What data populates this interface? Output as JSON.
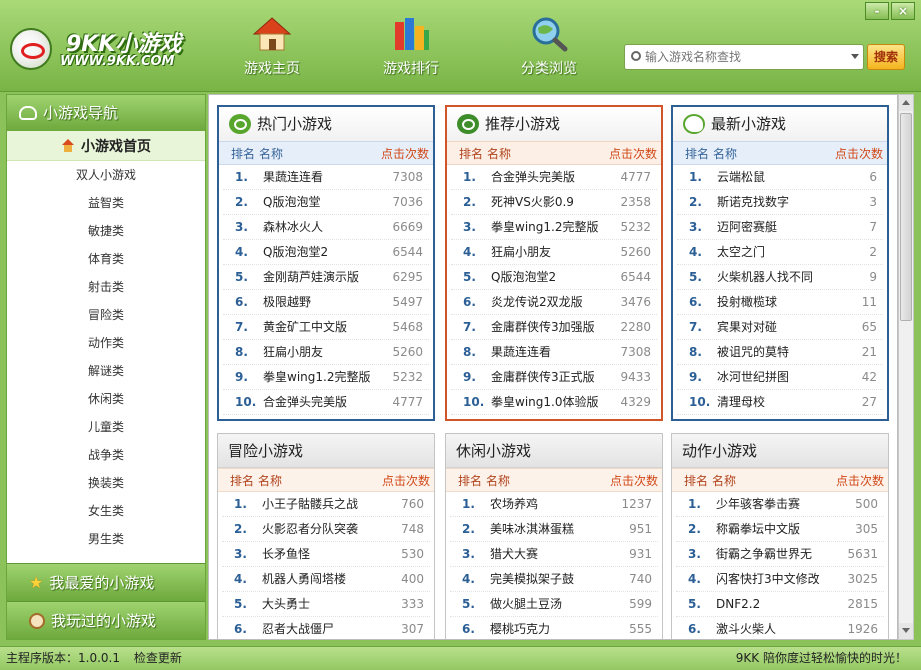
{
  "app": {
    "logo_title": "9KK小游戏",
    "logo_url": "WWW.9KK.COM",
    "window_controls": [
      "-",
      "×"
    ]
  },
  "nav": [
    {
      "label": "游戏主页",
      "icon": "house-icon"
    },
    {
      "label": "游戏排行",
      "icon": "books-icon"
    },
    {
      "label": "分类浏览",
      "icon": "magnifier-globe-icon"
    }
  ],
  "search": {
    "placeholder": "输入游戏名称查找",
    "button": "搜索"
  },
  "sidebar": {
    "title": "小游戏导航",
    "home": "小游戏首页",
    "items": [
      "双人小游戏",
      "益智类",
      "敏捷类",
      "体育类",
      "射击类",
      "冒险类",
      "动作类",
      "解谜类",
      "休闲类",
      "儿童类",
      "战争类",
      "换装类",
      "女生类",
      "男生类"
    ],
    "favorites": "我最爱的小游戏",
    "played": "我玩过的小游戏"
  },
  "columns": {
    "rank": "排名",
    "name": "名称",
    "clicks": "点击次数"
  },
  "panels": [
    {
      "title": "热门小游戏",
      "rows": [
        {
          "rank": "1.",
          "name": "果蔬连连看",
          "clicks": "7308"
        },
        {
          "rank": "2.",
          "name": "Q版泡泡堂",
          "clicks": "7036"
        },
        {
          "rank": "3.",
          "name": "森林冰火人",
          "clicks": "6669"
        },
        {
          "rank": "4.",
          "name": "Q版泡泡堂2",
          "clicks": "6544"
        },
        {
          "rank": "5.",
          "name": "金刚葫芦娃演示版",
          "clicks": "6295"
        },
        {
          "rank": "6.",
          "name": "极限越野",
          "clicks": "5497"
        },
        {
          "rank": "7.",
          "name": "黄金矿工中文版",
          "clicks": "5468"
        },
        {
          "rank": "8.",
          "name": "狂扁小朋友",
          "clicks": "5260"
        },
        {
          "rank": "9.",
          "name": "拳皇wing1.2完整版",
          "clicks": "5232"
        },
        {
          "rank": "10.",
          "name": "合金弹头完美版",
          "clicks": "4777"
        }
      ]
    },
    {
      "title": "推荐小游戏",
      "rows": [
        {
          "rank": "1.",
          "name": "合金弹头完美版",
          "clicks": "4777"
        },
        {
          "rank": "2.",
          "name": "死神VS火影0.9",
          "clicks": "2358"
        },
        {
          "rank": "3.",
          "name": "拳皇wing1.2完整版",
          "clicks": "5232"
        },
        {
          "rank": "4.",
          "name": "狂扁小朋友",
          "clicks": "5260"
        },
        {
          "rank": "5.",
          "name": "Q版泡泡堂2",
          "clicks": "6544"
        },
        {
          "rank": "6.",
          "name": "炎龙传说2双龙版",
          "clicks": "3476"
        },
        {
          "rank": "7.",
          "name": "金庸群侠传3加强版",
          "clicks": "2280"
        },
        {
          "rank": "8.",
          "name": "果蔬连连看",
          "clicks": "7308"
        },
        {
          "rank": "9.",
          "name": "金庸群侠传3正式版",
          "clicks": "9433"
        },
        {
          "rank": "10.",
          "name": "拳皇wing1.0体验版",
          "clicks": "4329"
        }
      ]
    },
    {
      "title": "最新小游戏",
      "rows": [
        {
          "rank": "1.",
          "name": "云端松鼠",
          "clicks": "6"
        },
        {
          "rank": "2.",
          "name": "斯诺克找数字",
          "clicks": "3"
        },
        {
          "rank": "3.",
          "name": "迈阿密赛艇",
          "clicks": "7"
        },
        {
          "rank": "4.",
          "name": "太空之门",
          "clicks": "2"
        },
        {
          "rank": "5.",
          "name": "火柴机器人找不同",
          "clicks": "9"
        },
        {
          "rank": "6.",
          "name": "投射橄榄球",
          "clicks": "11"
        },
        {
          "rank": "7.",
          "name": "宾果对对碰",
          "clicks": "65"
        },
        {
          "rank": "8.",
          "name": "被诅咒的莫特",
          "clicks": "21"
        },
        {
          "rank": "9.",
          "name": "冰河世纪拼图",
          "clicks": "42"
        },
        {
          "rank": "10.",
          "name": "清理母校",
          "clicks": "27"
        }
      ]
    },
    {
      "title": "冒险小游戏",
      "rows": [
        {
          "rank": "1.",
          "name": "小王子骷髅兵之战",
          "clicks": "760"
        },
        {
          "rank": "2.",
          "name": "火影忍者分队突袭",
          "clicks": "748"
        },
        {
          "rank": "3.",
          "name": "长矛鱼怪",
          "clicks": "530"
        },
        {
          "rank": "4.",
          "name": "机器人勇闯塔楼",
          "clicks": "400"
        },
        {
          "rank": "5.",
          "name": "大头勇士",
          "clicks": "333"
        },
        {
          "rank": "6.",
          "name": "忍者大战僵尸",
          "clicks": "307"
        }
      ]
    },
    {
      "title": "休闲小游戏",
      "rows": [
        {
          "rank": "1.",
          "name": "农场养鸡",
          "clicks": "1237"
        },
        {
          "rank": "2.",
          "name": "美味冰淇淋蛋糕",
          "clicks": "951"
        },
        {
          "rank": "3.",
          "name": "猎犬大赛",
          "clicks": "931"
        },
        {
          "rank": "4.",
          "name": "完美模拟架子鼓",
          "clicks": "740"
        },
        {
          "rank": "5.",
          "name": "做火腿土豆汤",
          "clicks": "599"
        },
        {
          "rank": "6.",
          "name": "樱桃巧克力",
          "clicks": "555"
        }
      ]
    },
    {
      "title": "动作小游戏",
      "rows": [
        {
          "rank": "1.",
          "name": "少年骇客拳击赛",
          "clicks": "500"
        },
        {
          "rank": "2.",
          "name": "称霸拳坛中文版",
          "clicks": "305"
        },
        {
          "rank": "3.",
          "name": "街霸之争霸世界无",
          "clicks": "5631"
        },
        {
          "rank": "4.",
          "name": "闪客快打3中文修改",
          "clicks": "3025"
        },
        {
          "rank": "5.",
          "name": "DNF2.2",
          "clicks": "2815"
        },
        {
          "rank": "6.",
          "name": "激斗火柴人",
          "clicks": "1926"
        }
      ]
    }
  ],
  "status": {
    "version": "主程序版本：1.0.0.1",
    "update": "检查更新",
    "tagline": "9KK 陪你度过轻松愉快的时光！"
  }
}
